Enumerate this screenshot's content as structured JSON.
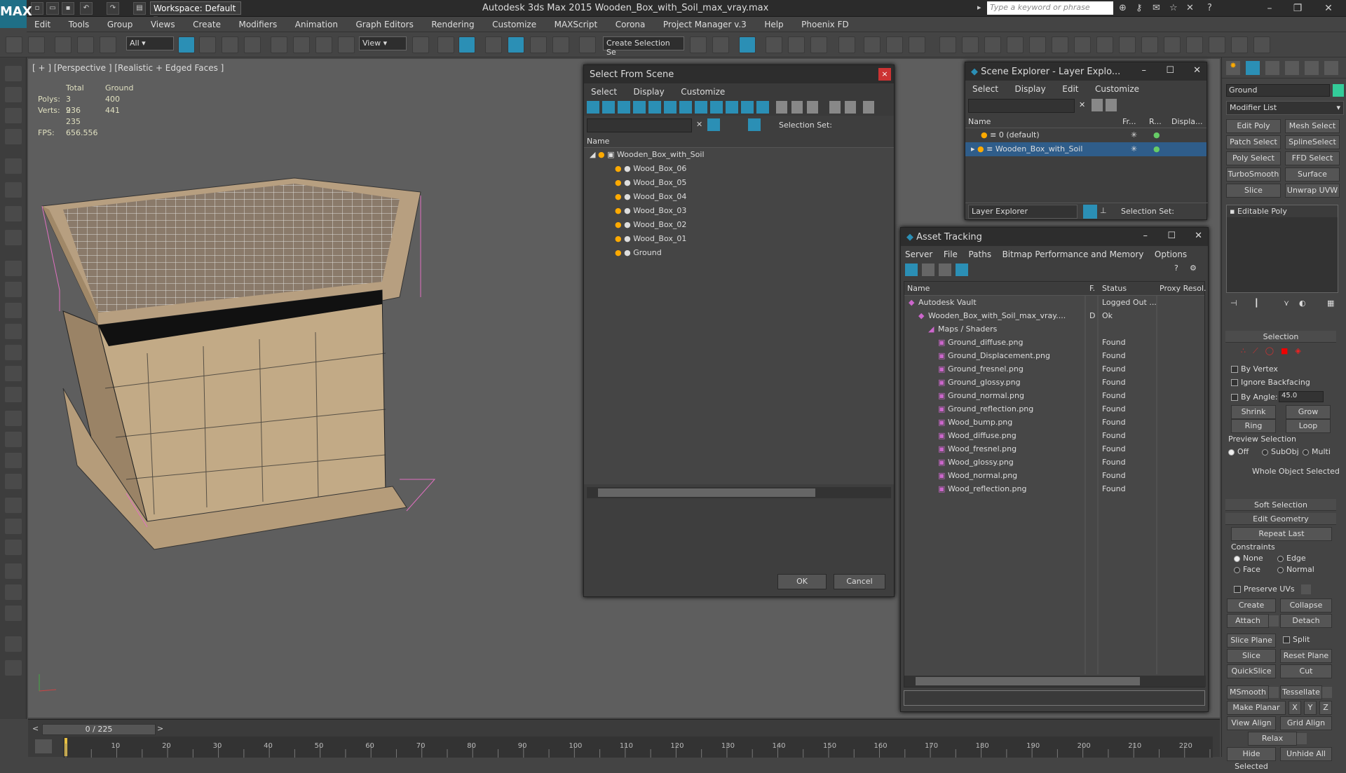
{
  "app": {
    "workspace": "Workspace: Default",
    "title": "Autodesk 3ds Max  2015     Wooden_Box_with_Soil_max_vray.max",
    "search_placeholder": "Type a keyword or phrase",
    "logo": "MAX"
  },
  "menu": [
    "Edit",
    "Tools",
    "Group",
    "Views",
    "Create",
    "Modifiers",
    "Animation",
    "Graph Editors",
    "Rendering",
    "Customize",
    "MAXScript",
    "Corona",
    "Project Manager v.3",
    "Help",
    "Phoenix FD"
  ],
  "toolbar": {
    "filter": "All",
    "refcoord": "View",
    "selset": "Create Selection Se"
  },
  "viewport": {
    "label": "[ + ] [Perspective ] [Realistic + Edged Faces ]",
    "stats_hdr_total": "Total",
    "stats_hdr_ground": "Ground",
    "polys_label": "Polys:",
    "polys_total": "3 936",
    "polys_ground": "400",
    "verts_label": "Verts:",
    "verts_total": "2 235",
    "verts_ground": "441",
    "fps_label": "FPS:",
    "fps": "656.556"
  },
  "select_scene": {
    "title": "Select From Scene",
    "menu": [
      "Select",
      "Display",
      "Customize"
    ],
    "selection_set": "Selection Set:",
    "col_name": "Name",
    "root": "Wooden_Box_with_Soil",
    "items": [
      "Wood_Box_06",
      "Wood_Box_05",
      "Wood_Box_04",
      "Wood_Box_03",
      "Wood_Box_02",
      "Wood_Box_01",
      "Ground"
    ],
    "ok": "OK",
    "cancel": "Cancel"
  },
  "scene_explorer": {
    "title": "Scene Explorer - Layer Explo...",
    "menu": [
      "Select",
      "Display",
      "Edit",
      "Customize"
    ],
    "cols": [
      "Name",
      "Fr...",
      "R...",
      "Displa..."
    ],
    "rows": [
      "0 (default)",
      "Wooden_Box_with_Soil"
    ],
    "layer_explorer": "Layer Explorer",
    "selection_set": "Selection Set:"
  },
  "asset": {
    "title": "Asset Tracking",
    "menu": [
      "Server",
      "File",
      "Paths",
      "Bitmap Performance and Memory",
      "Options"
    ],
    "cols": [
      "Name",
      "F.",
      "Status",
      "Proxy Resol."
    ],
    "rows": [
      {
        "name": "Autodesk Vault",
        "f": "",
        "status": "Logged Out ...",
        "indent": 1
      },
      {
        "name": "Wooden_Box_with_Soil_max_vray....",
        "f": "D",
        "status": "Ok",
        "indent": 2
      },
      {
        "name": "Maps / Shaders",
        "f": "",
        "status": "",
        "indent": 3
      },
      {
        "name": "Ground_diffuse.png",
        "f": "",
        "status": "Found",
        "indent": 4
      },
      {
        "name": "Ground_Displacement.png",
        "f": "",
        "status": "Found",
        "indent": 4
      },
      {
        "name": "Ground_fresnel.png",
        "f": "",
        "status": "Found",
        "indent": 4
      },
      {
        "name": "Ground_glossy.png",
        "f": "",
        "status": "Found",
        "indent": 4
      },
      {
        "name": "Ground_normal.png",
        "f": "",
        "status": "Found",
        "indent": 4
      },
      {
        "name": "Ground_reflection.png",
        "f": "",
        "status": "Found",
        "indent": 4
      },
      {
        "name": "Wood_bump.png",
        "f": "",
        "status": "Found",
        "indent": 4
      },
      {
        "name": "Wood_diffuse.png",
        "f": "",
        "status": "Found",
        "indent": 4
      },
      {
        "name": "Wood_fresnel.png",
        "f": "",
        "status": "Found",
        "indent": 4
      },
      {
        "name": "Wood_glossy.png",
        "f": "",
        "status": "Found",
        "indent": 4
      },
      {
        "name": "Wood_normal.png",
        "f": "",
        "status": "Found",
        "indent": 4
      },
      {
        "name": "Wood_reflection.png",
        "f": "",
        "status": "Found",
        "indent": 4
      }
    ]
  },
  "cmd": {
    "object_name": "Ground",
    "modifier_list": "Modifier List",
    "mod_buttons": [
      "Edit Poly",
      "Mesh Select",
      "Patch Select",
      "SplineSelect",
      "Poly Select",
      "FFD Select",
      "TurboSmooth",
      "Surface Select",
      "Slice",
      "Unwrap UVW"
    ],
    "stack_item": "Editable Poly",
    "selection": "Selection",
    "by_vertex": "By Vertex",
    "ignore_backfacing": "Ignore Backfacing",
    "by_angle": "By Angle:",
    "angle_value": "45.0",
    "shrink": "Shrink",
    "grow": "Grow",
    "ring": "Ring",
    "loop": "Loop",
    "preview_selection": "Preview Selection",
    "off": "Off",
    "subobj": "SubObj",
    "multi": "Multi",
    "whole_object": "Whole Object Selected",
    "soft_selection": "Soft Selection",
    "edit_geometry": "Edit Geometry",
    "repeat_last": "Repeat Last",
    "constraints": "Constraints",
    "none": "None",
    "edge": "Edge",
    "face": "Face",
    "normal": "Normal",
    "preserve_uvs": "Preserve UVs",
    "create": "Create",
    "collapse": "Collapse",
    "attach": "Attach",
    "detach": "Detach",
    "slice_plane": "Slice Plane",
    "split": "Split",
    "slice": "Slice",
    "reset_plane": "Reset Plane",
    "quickslice": "QuickSlice",
    "cut": "Cut",
    "msmooth": "MSmooth",
    "tessellate": "Tessellate",
    "make_planar": "Make Planar",
    "x": "X",
    "y": "Y",
    "z": "Z",
    "view_align": "View Align",
    "grid_align": "Grid Align",
    "relax": "Relax",
    "hide_selected": "Hide Selected",
    "unhide_all": "Unhide All"
  },
  "timeline": {
    "frame": "0 / 225",
    "ticks": [
      "10",
      "20",
      "30",
      "40",
      "50",
      "60",
      "70",
      "80",
      "90",
      "100",
      "110",
      "120",
      "130",
      "140",
      "150",
      "160",
      "170",
      "180",
      "190",
      "200",
      "210",
      "220"
    ]
  }
}
